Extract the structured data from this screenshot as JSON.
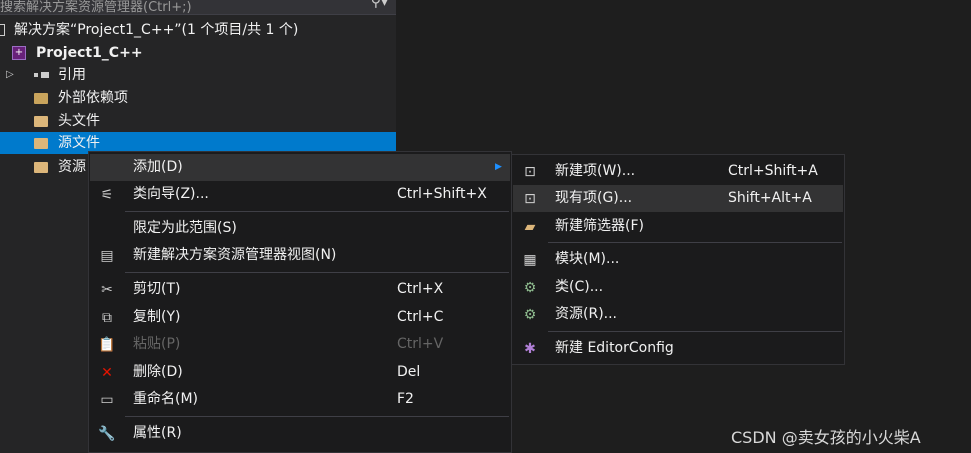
{
  "explorer": {
    "search_placeholder": "搜索解决方案资源管理器(Ctrl+;)",
    "solution_label": "解决方案“Project1_C++”(1 个项目/共 1 个)",
    "project_label": "Project1_C++",
    "items": [
      {
        "label": "引用"
      },
      {
        "label": "外部依赖项"
      },
      {
        "label": "头文件"
      },
      {
        "label": "源文件"
      },
      {
        "label": "资源"
      }
    ]
  },
  "context_menu": {
    "items": [
      {
        "label": "添加(D)",
        "shortcut": ""
      },
      {
        "label": "类向导(Z)...",
        "shortcut": "Ctrl+Shift+X"
      },
      {
        "label": "限定为此范围(S)",
        "shortcut": ""
      },
      {
        "label": "新建解决方案资源管理器视图(N)",
        "shortcut": ""
      },
      {
        "label": "剪切(T)",
        "shortcut": "Ctrl+X"
      },
      {
        "label": "复制(Y)",
        "shortcut": "Ctrl+C"
      },
      {
        "label": "粘贴(P)",
        "shortcut": "Ctrl+V"
      },
      {
        "label": "删除(D)",
        "shortcut": "Del"
      },
      {
        "label": "重命名(M)",
        "shortcut": "F2"
      },
      {
        "label": "属性(R)",
        "shortcut": ""
      }
    ]
  },
  "submenu": {
    "items": [
      {
        "label": "新建项(W)...",
        "shortcut": "Ctrl+Shift+A"
      },
      {
        "label": "现有项(G)...",
        "shortcut": "Shift+Alt+A"
      },
      {
        "label": "新建筛选器(F)",
        "shortcut": ""
      },
      {
        "label": "模块(M)...",
        "shortcut": ""
      },
      {
        "label": "类(C)...",
        "shortcut": ""
      },
      {
        "label": "资源(R)...",
        "shortcut": ""
      },
      {
        "label": "新建 EditorConfig",
        "shortcut": ""
      }
    ]
  },
  "watermark": "CSDN @卖女孩的小火柴A",
  "colors": {
    "selection": "#007acc",
    "menu_bg": "#1b1b1c",
    "highlight": "#333334",
    "folder": "#dcb67a"
  }
}
